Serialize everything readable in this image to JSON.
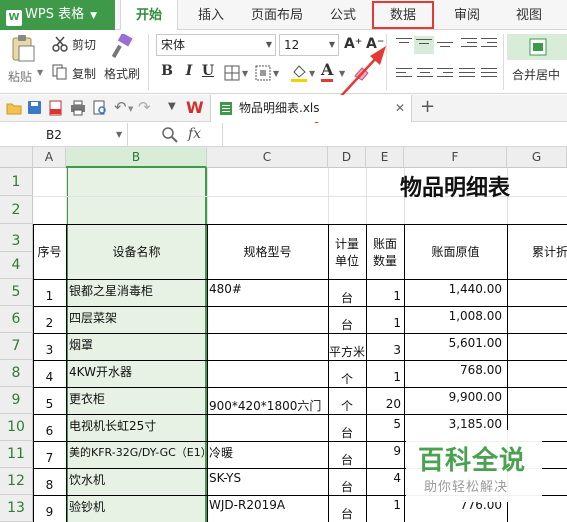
{
  "app": {
    "name": "WPS 表格",
    "logo_letter": "W"
  },
  "tabs": [
    {
      "label": "开始",
      "active": true
    },
    {
      "label": "插入"
    },
    {
      "label": "页面布局"
    },
    {
      "label": "公式"
    },
    {
      "label": "数据",
      "highlighted": true
    },
    {
      "label": "审阅"
    },
    {
      "label": "视图"
    }
  ],
  "ribbon": {
    "paste": "粘贴",
    "cut": "剪切",
    "copy": "复制",
    "format_painter": "格式刷",
    "font_name": "宋体",
    "font_size": "12",
    "grow_font": "A⁺",
    "shrink_font": "A⁻",
    "bold": "B",
    "italic": "I",
    "underline": "U",
    "merge_center": "合并居中",
    "accent_color": "#3e9a48",
    "highlight_color": "#e53935"
  },
  "document": {
    "filename": "物品明细表.xls"
  },
  "formula_bar": {
    "cell_ref": "B2",
    "fx": "fx",
    "content": ""
  },
  "sheet": {
    "columns": [
      "A",
      "B",
      "C",
      "D",
      "E",
      "F",
      "G"
    ],
    "rows": [
      "1",
      "2",
      "3",
      "4",
      "5",
      "6",
      "7",
      "8",
      "9",
      "10",
      "11",
      "12",
      "13"
    ],
    "title": "物品明细表",
    "headers": {
      "seq": "序号",
      "name": "设备名称",
      "spec": "规格型号",
      "unit_1": "计量",
      "unit_2": "单位",
      "qty_1": "账面",
      "qty_2": "数量",
      "value": "账面原值",
      "accum": "累计折"
    },
    "data": [
      {
        "seq": "1",
        "name": "银都之星消毒柜",
        "spec": "480#",
        "unit": "台",
        "qty": "1",
        "value": "1,440.00"
      },
      {
        "seq": "2",
        "name": "四层菜架",
        "spec": "",
        "unit": "台",
        "qty": "1",
        "value": "1,008.00"
      },
      {
        "seq": "3",
        "name": "烟罩",
        "spec": "",
        "unit": "平方米",
        "qty": "3",
        "value": "5,601.00"
      },
      {
        "seq": "4",
        "name": "4KW开水器",
        "spec": "",
        "unit": "个",
        "qty": "1",
        "value": "768.00"
      },
      {
        "seq": "5",
        "name": "更衣柜",
        "spec": "900*420*1800六门",
        "unit": "个",
        "qty": "20",
        "value": "9,900.00"
      },
      {
        "seq": "6",
        "name": "电视机长虹25寸",
        "spec": "",
        "unit": "台",
        "qty": "5",
        "value": "3,185.00"
      },
      {
        "seq": "7",
        "name": "美的KFR-32G/DY-GC（E1）",
        "spec": "冷暖",
        "unit": "台",
        "qty": "9",
        "value": ""
      },
      {
        "seq": "8",
        "name": "饮水机",
        "spec": "SK-YS",
        "unit": "台",
        "qty": "4",
        "value": ""
      },
      {
        "seq": "9",
        "name": "验钞机",
        "spec": "WJD-R2019A",
        "unit": "台",
        "qty": "1",
        "value": "776.00"
      }
    ]
  },
  "watermark": {
    "title": "百科全说",
    "subtitle": "助你轻松解决"
  }
}
